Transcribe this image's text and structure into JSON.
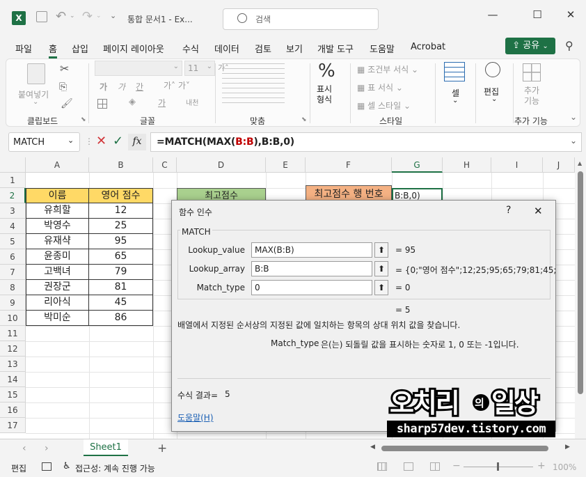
{
  "titlebar": {
    "app_icon": "excel-icon",
    "autosave_icon": "save-icon",
    "undo_icon": "undo-icon",
    "redo_icon": "redo-icon",
    "title": "통합 문서1  -  Ex...",
    "search_placeholder": "검색",
    "minimize": "—",
    "maximize": "☐",
    "close": "✕"
  },
  "menu": [
    "파일",
    "홈",
    "삽입",
    "페이지 레이아웃",
    "수식",
    "데이터",
    "검토",
    "보기",
    "개발 도구",
    "도움말",
    "Acrobat"
  ],
  "menu_active": "홈",
  "share_label": "공유",
  "ribbon": {
    "clipboard": {
      "paste": "붙여넣기",
      "label": "클립보드"
    },
    "font": {
      "name": "",
      "size": "11",
      "bold": "가",
      "italic": "가",
      "underline": "간",
      "label": "글꼴"
    },
    "align": {
      "label": "맞춤"
    },
    "number": {
      "percent": "%",
      "fmt": "표시\n형식",
      "label": "표시 형식"
    },
    "styles": {
      "cond": "조건부 서식",
      "table": "표 서식",
      "cell": "셀 스타일",
      "label": "스타일"
    },
    "cells": {
      "label": "셀"
    },
    "edit": {
      "label": "편집"
    },
    "addins": {
      "label": "추가\n기능",
      "group": "추가 기능"
    }
  },
  "formula_bar": {
    "name_box": "MATCH",
    "fx": "fx",
    "formula": "=MATCH(MAX(B:B),B:B,0)",
    "formula_parts": [
      "=MATCH(MAX(",
      "B:B",
      "),",
      "B:B",
      ",0)"
    ]
  },
  "columns": [
    "A",
    "B",
    "C",
    "D",
    "E",
    "F",
    "G",
    "H",
    "I",
    "J"
  ],
  "rows": [
    "1",
    "2",
    "3",
    "4",
    "5",
    "6",
    "7",
    "8",
    "9",
    "10",
    "11",
    "12",
    "13",
    "14",
    "15",
    "16",
    "17"
  ],
  "table": {
    "header": [
      "이름",
      "영어 점수"
    ],
    "rows": [
      [
        "유희할",
        "12"
      ],
      [
        "박영수",
        "25"
      ],
      [
        "유재샥",
        "95"
      ],
      [
        "윤종미",
        "65"
      ],
      [
        "고백녀",
        "79"
      ],
      [
        "권장군",
        "81"
      ],
      [
        "리아식",
        "45"
      ],
      [
        "박미순",
        "86"
      ]
    ]
  },
  "d2": "최고점수",
  "f2": "최고점수 행 번호",
  "g2": "B:B,0)",
  "dialog": {
    "title": "함수 인수",
    "help_btn": "?",
    "close_btn": "✕",
    "fn": "MATCH",
    "args": [
      {
        "name": "Lookup_value",
        "value": "MAX(B:B)",
        "result": "=  95"
      },
      {
        "name": "Lookup_array",
        "value": "B:B",
        "result": "=  {0;\"영어 점수\";12;25;95;65;79;81;45;"
      },
      {
        "name": "Match_type",
        "value": "0",
        "result": "=  0"
      }
    ],
    "total": "=  5",
    "desc": "배열에서 지정된 순서상의 지정된 값에 일치하는 항목의 상대 위치 값을 찾습니다.",
    "arg_name": "Match_type",
    "arg_desc": "은(는) 되돌릴 값을 표시하는 숫자로 1, 0 또는 -1입니다.",
    "result_label": "수식 결과=",
    "result_value": "5",
    "help_link": "도움말(H)"
  },
  "sheet_tab": "Sheet1",
  "status": {
    "mode": "편집",
    "access": "접근성: 계속 진행 가능",
    "zoom": "100%"
  },
  "watermark": {
    "title_main": "오치리",
    "title_mid": "의",
    "title_end": "일상",
    "url": "sharp57dev.tistory.com"
  },
  "colors": {
    "excel_green": "#1e7145",
    "header_yellow": "#ffd966",
    "d2_green": "#a9d08e",
    "f2_orange": "#f4b183"
  }
}
